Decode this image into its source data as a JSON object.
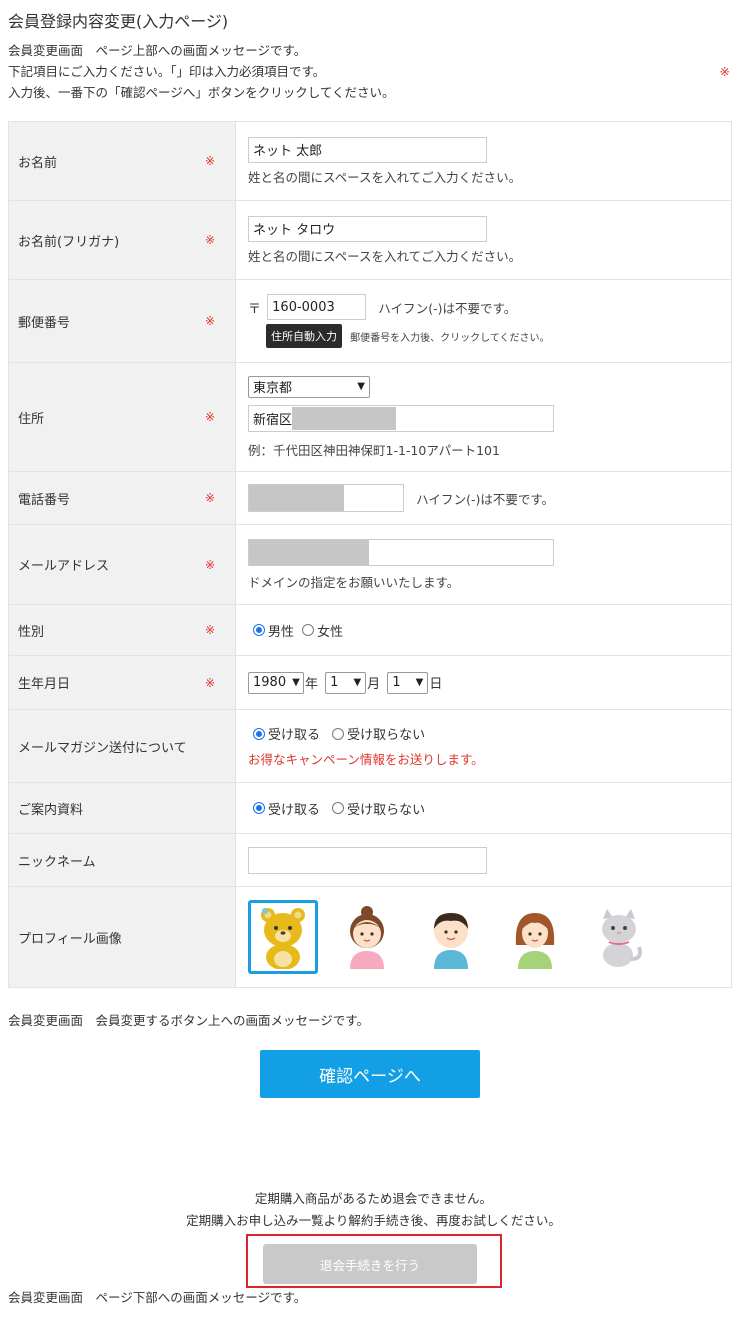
{
  "page": {
    "title": "会員登録内容変更(入力ページ)",
    "intro": {
      "line1": "会員変更画面　ページ上部への画面メッセージです。",
      "line2": "下記項目にご入力ください。「」印は入力必須項目です。",
      "line3": "入力後、一番下の「確認ページへ」ボタンをクリックしてください。",
      "required_mark": "※"
    }
  },
  "form": {
    "required_mark": "※",
    "name": {
      "label": "お名前",
      "value": "ネット 太郎",
      "hint": "姓と名の間にスペースを入れてご入力ください。"
    },
    "kana": {
      "label": "お名前(フリガナ)",
      "value": "ネット タロウ",
      "hint": "姓と名の間にスペースを入れてご入力ください。"
    },
    "zip": {
      "label": "郵便番号",
      "prefix": "〒",
      "value": "160-0003",
      "note": "ハイフン(-)は不要です。",
      "auto_button": "住所自動入力",
      "auto_note": "郵便番号を入力後、クリックしてください。"
    },
    "address": {
      "label": "住所",
      "prefecture": "東京都",
      "value": "新宿区",
      "example": "例：千代田区神田神保町1-1-10アパート101"
    },
    "phone": {
      "label": "電話番号",
      "note": "ハイフン(-)は不要です。"
    },
    "email": {
      "label": "メールアドレス",
      "hint": "ドメインの指定をお願いいたします。"
    },
    "gender": {
      "label": "性別",
      "options": [
        "男性",
        "女性"
      ],
      "selected": "男性"
    },
    "birthday": {
      "label": "生年月日",
      "year": "1980",
      "year_unit": "年",
      "month": "1",
      "month_unit": "月",
      "day": "1",
      "day_unit": "日"
    },
    "magazine": {
      "label": "メールマガジン送付について",
      "options": [
        "受け取る",
        "受け取らない"
      ],
      "selected": "受け取る",
      "message": "お得なキャンペーン情報をお送りします。"
    },
    "brochure": {
      "label": "ご案内資料",
      "options": [
        "受け取る",
        "受け取らない"
      ],
      "selected": "受け取る"
    },
    "nickname": {
      "label": "ニックネーム",
      "value": ""
    },
    "profile_image": {
      "label": "プロフィール画像",
      "avatars": [
        "bear",
        "girl",
        "boy",
        "woman",
        "cat"
      ],
      "selected": "bear"
    }
  },
  "bottom": {
    "above_button_msg": "会員変更画面　会員変更するボタン上への画面メッセージです。",
    "confirm_button": "確認ページへ",
    "notice_line1": "定期購入商品があるため退会できません。",
    "notice_line2": "定期購入お申し込み一覧より解約手続き後、再度お試しください。",
    "withdraw_button": "退会手続きを行う",
    "footer_msg": "会員変更画面　ページ下部への画面メッセージです。"
  },
  "colors": {
    "accent": "#139fe5",
    "required": "#e0362c",
    "highlight_frame": "#d9262c",
    "disabled_button": "#c9c9c9"
  }
}
